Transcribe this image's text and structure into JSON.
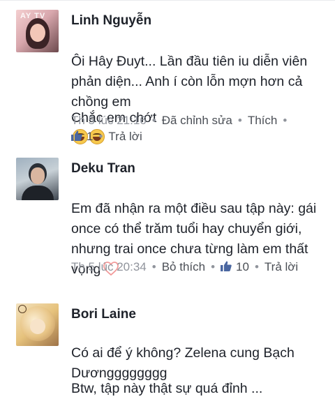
{
  "comments": [
    {
      "author": "Linh Nguyễn",
      "avatar_text": "AY TV",
      "text_main": "Ôi Hây Đuyt... Lần đầu tiên iu diễn viên phản diện... Anh í còn lỗn mợn hơn cả chồng em",
      "text_extra": "Chắc em chớt",
      "emoji": "grinning-sweat-emoji",
      "time": "Th 5 lúc 21:16",
      "edited": "Đã chỉnh sửa",
      "like": "Thích",
      "like_count": "1",
      "reply": "Trả lời"
    },
    {
      "author": "Deku Tran",
      "text_main": "Em đã nhận ra một điều sau tập này: gái once có thể trăm tuổi hay chuyển giới, nhưng trai once chưa từng làm em thất vọng",
      "emoji": "heart-icon",
      "time": "Th 5 lúc 20:34",
      "unlike": "Bỏ thích",
      "like_count": "10",
      "reply": "Trả lời"
    },
    {
      "author": "Bori Laine",
      "text_main": "Có ai để ý không? Zelena cung Bạch Dươngggggggg",
      "text_extra": "Btw, tập này thật sự quá đỉnh ..."
    }
  ],
  "colors": {
    "name": "#1d2129",
    "meta": "#90949c",
    "link": "#4b4f56",
    "like_icon": "#4b67a1",
    "heart": "#f29a9a"
  }
}
